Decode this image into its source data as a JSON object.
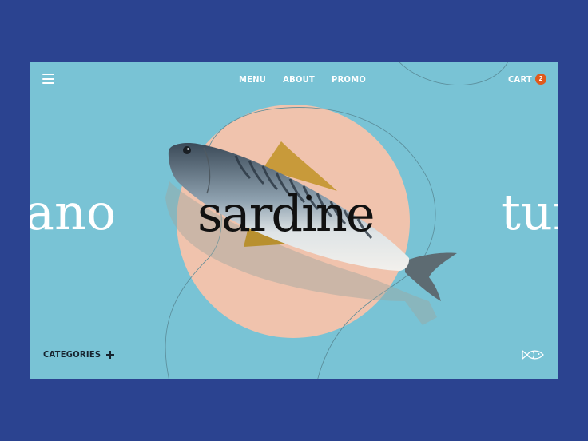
{
  "header": {
    "nav": [
      {
        "label": "MENU"
      },
      {
        "label": "ABOUT"
      },
      {
        "label": "PROMO"
      }
    ],
    "cart": {
      "label": "CART",
      "count": "2"
    }
  },
  "hero": {
    "prev_word": "ano",
    "title": "sardine",
    "next_word": "tur"
  },
  "footer": {
    "categories_label": "CATEGORIES"
  },
  "icons": {
    "menu": "hamburger-menu-icon",
    "plus": "plus-icon",
    "fish": "fish-outline-icon",
    "hero_image": "mackerel-fish-photo"
  },
  "colors": {
    "page_background": "#2b4390",
    "card_background": "#79c3d5",
    "circle": "#f0c3ad",
    "badge": "#e05a1c",
    "title_text": "#111111"
  }
}
